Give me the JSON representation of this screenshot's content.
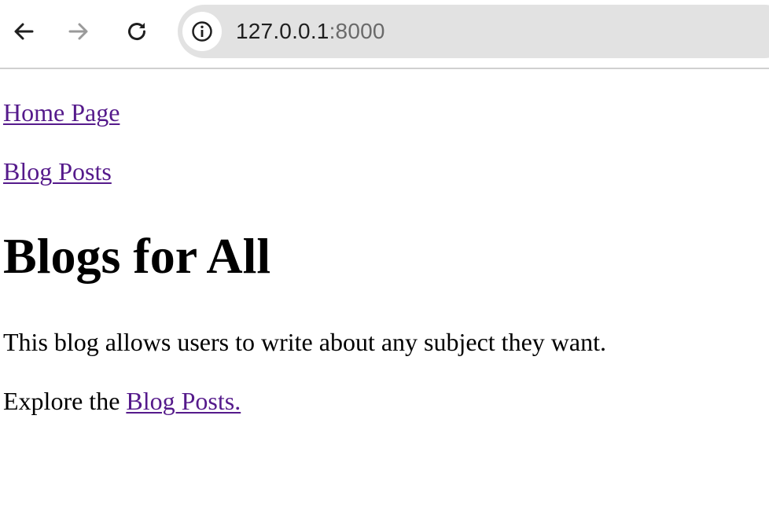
{
  "browser": {
    "url_host": "127.0.0.1",
    "url_port": ":8000",
    "icons": {
      "back": "arrow-left-icon",
      "forward": "arrow-right-icon",
      "reload": "reload-icon",
      "site_info": "info-icon"
    }
  },
  "page": {
    "nav_links": {
      "home": "Home Page",
      "blog_posts": "Blog Posts"
    },
    "title": "Blogs for All",
    "description": "This blog allows users to write about any subject they want.",
    "explore_prefix": "Explore the ",
    "explore_link": "Blog Posts."
  },
  "colors": {
    "visited_link": "#551a8b",
    "omnibox_bg": "#e2e2e2"
  }
}
